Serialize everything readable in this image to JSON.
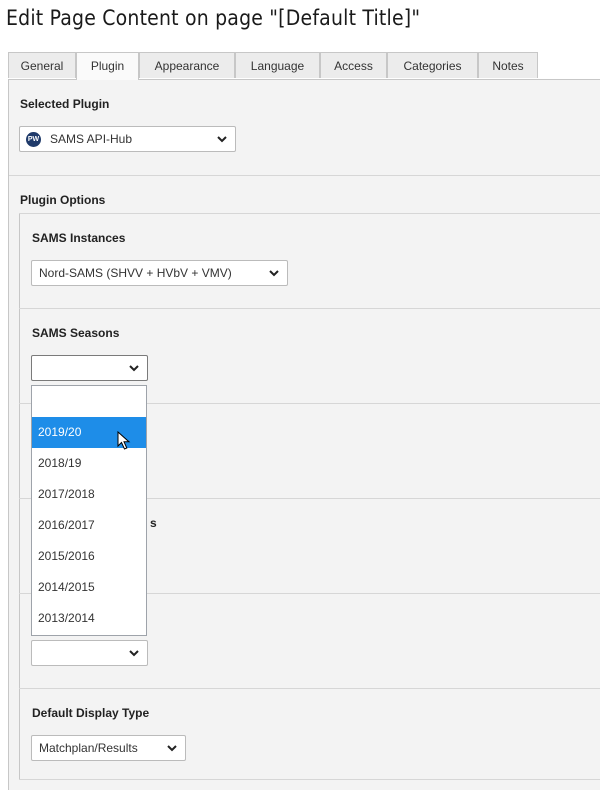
{
  "page": {
    "title": "Edit Page Content on page \"[Default Title]\""
  },
  "tabs": [
    {
      "label": "General"
    },
    {
      "label": "Plugin"
    },
    {
      "label": "Appearance"
    },
    {
      "label": "Language"
    },
    {
      "label": "Access"
    },
    {
      "label": "Categories"
    },
    {
      "label": "Notes"
    }
  ],
  "active_tab": "Plugin",
  "selected_plugin": {
    "heading": "Selected Plugin",
    "value": "SAMS API-Hub",
    "icon_text": "PW"
  },
  "plugin_options": {
    "heading": "Plugin Options",
    "instances": {
      "heading": "SAMS Instances",
      "value": "Nord-SAMS (SHVV + HVbV + VMV)"
    },
    "seasons": {
      "heading": "SAMS Seasons",
      "value": "",
      "options": [
        "",
        "2019/20",
        "2018/19",
        "2017/2018",
        "2016/2017",
        "2015/2016",
        "2014/2015",
        "2013/2014"
      ],
      "highlighted": "2019/20"
    },
    "hidden_heading_fragment": "s",
    "lower_select_value": "",
    "display_type": {
      "heading": "Default Display Type",
      "value": "Matchplan/Results"
    }
  },
  "colors": {
    "highlight": "#1e8de8",
    "panel": "#f3f3f3",
    "icon": "#1f3a6a"
  }
}
